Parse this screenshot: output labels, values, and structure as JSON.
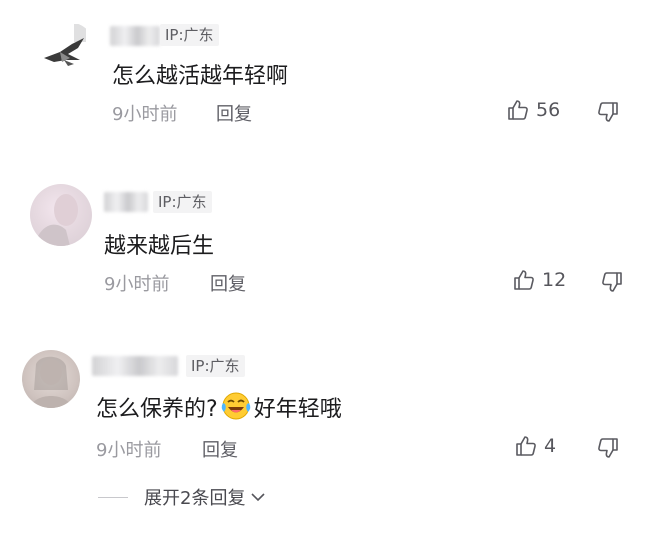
{
  "comments": [
    {
      "ip": "IP:广东",
      "content": "怎么越活越年轻啊",
      "time": "9小时前",
      "reply": "回复",
      "likes": "56"
    },
    {
      "ip": "IP:广东",
      "content": "越来越后生",
      "time": "9小时前",
      "reply": "回复",
      "likes": "12"
    },
    {
      "ip": "IP:广东",
      "content_before": "怎么保养的?",
      "emoji": "laughing-crying-emoji",
      "content_after": "好年轻哦",
      "time": "9小时前",
      "reply": "回复",
      "likes": "4"
    }
  ],
  "expand_replies": "展开2条回复",
  "icons": {
    "like": "thumbs-up-icon",
    "dislike": "thumbs-down-icon",
    "expand": "chevron-down-icon"
  },
  "colors": {
    "text": "#1c1c1e",
    "meta": "#9a9aa0",
    "tag_bg": "#f3f3f4"
  }
}
